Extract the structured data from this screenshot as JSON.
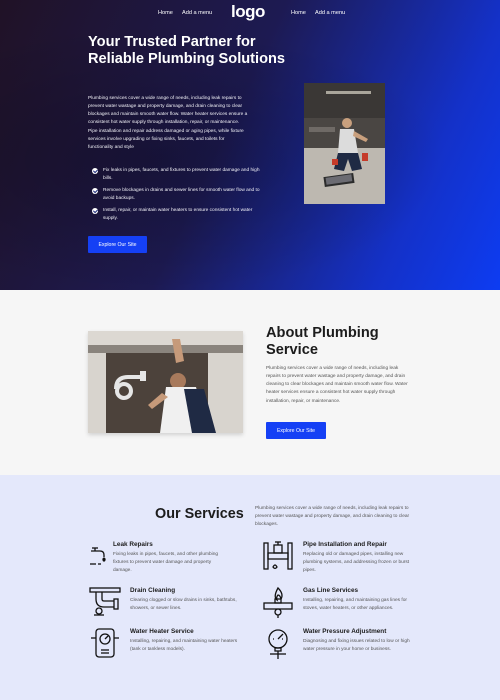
{
  "nav": {
    "left_links": [
      "Home",
      "Add a menu"
    ],
    "logo": "logo",
    "right_links": [
      "Home",
      "Add a menu"
    ]
  },
  "hero": {
    "title": "Your Trusted Partner for Reliable Plumbing Solutions",
    "text": "Plumbing services cover a wide range of needs, including leak repairs to prevent water wastage and property damage, and drain cleaning to clear blockages and maintain smooth water flow. Water heater services ensure a consistent hot water supply through installation, repair, or maintenance. Pipe installation and repair address damaged or aging pipes, while fixture services involve upgrading or fixing sinks, faucets, and toilets for functionality and style",
    "checklist": [
      "Fix leaks in pipes, faucets, and fixtures to prevent water damage and high bills.",
      "Remove blockages in drains and sewer lines for smooth water flow and to avoid backups.",
      "Install, repair, or maintain water heaters to ensure consistent hot water supply."
    ],
    "button": "Explore Our Site"
  },
  "about": {
    "title": "About Plumbing Service",
    "text": "Plumbing services cover a wide range of needs, including leak repairs to prevent water wastage and property damage, and drain cleaning to clear blockages and maintain smooth water flow. Water heater services ensure a consistent hot water supply through installation, repair, or maintenance.",
    "button": "Explore Our Site"
  },
  "services": {
    "title": "Our Services",
    "intro": "Plumbing services cover a wide range of needs, including leak repairs to prevent water wastage and property damage, and drain cleaning to clear blockages.",
    "items": [
      {
        "title": "Leak Repairs",
        "text": "Fixing leaks in pipes, faucets, and other plumbing fixtures to prevent water damage and property damage.",
        "icon": "leaking-faucet-icon"
      },
      {
        "title": "Pipe Installation and Repair",
        "text": "Replacing old or damaged pipes, installing new plumbing systems, and addressing frozen or burst pipes.",
        "icon": "pipe-valve-icon"
      },
      {
        "title": "Drain Cleaning",
        "text": "Clearing clogged or slow drains in sinks, bathtubs, showers, or sewer lines.",
        "icon": "drain-pipe-icon"
      },
      {
        "title": "Gas Line Services",
        "text": "Installing, repairing, and maintaining gas lines for stoves, water heaters, or other appliances.",
        "icon": "gas-flame-icon"
      },
      {
        "title": "Water Heater Service",
        "text": "Installing, repairing, and maintaining water heaters (tank or tankless models).",
        "icon": "water-heater-icon"
      },
      {
        "title": "Water Pressure Adjustment",
        "text": "Diagnosing and fixing issues related to low or high water pressure in your home or business.",
        "icon": "pressure-gauge-icon"
      }
    ]
  },
  "colors": {
    "accent": "#1540f5",
    "hero_dark": "#201226",
    "hero_blue": "#0d3cf2",
    "services_bg": "#e4e8fb"
  }
}
